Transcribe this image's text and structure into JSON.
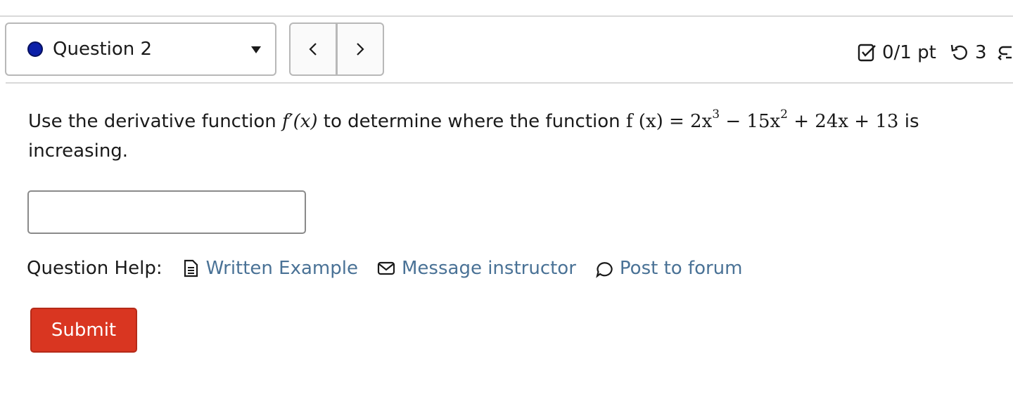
{
  "question_selector": {
    "label": "Question 2",
    "status_color": "#0b1fa8"
  },
  "nav": {
    "prev_icon": "chevron-left-icon",
    "next_icon": "chevron-right-icon"
  },
  "score": {
    "text": "0/1 pt"
  },
  "retries": {
    "text": "3"
  },
  "question": {
    "text_before": "Use the derivative function",
    "derivative": "f′(x)",
    "text_middle": "to determine where the function",
    "function_lhs": "f (x) = 2x",
    "exp1": "3",
    "term2": " − 15x",
    "exp2": "2",
    "term3": " + 24x + 13",
    "text_after": "is increasing."
  },
  "answer": {
    "value": "",
    "placeholder": ""
  },
  "help": {
    "label": "Question Help:",
    "written_example": "Written Example",
    "message_instructor": "Message instructor",
    "post_to_forum": "Post to forum"
  },
  "submit": {
    "label": "Submit",
    "color": "#d93621"
  },
  "colors": {
    "link": "#4a7296"
  }
}
